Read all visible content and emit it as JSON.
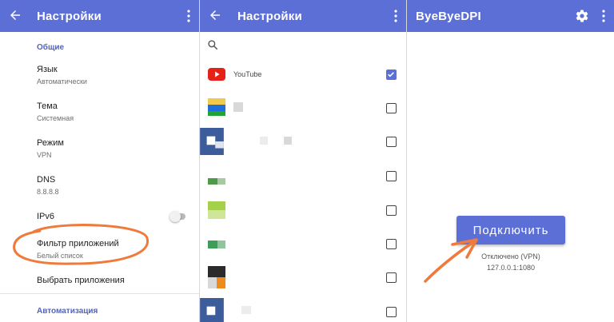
{
  "screens": [
    {
      "title": "Настройки",
      "general_section": "Общие",
      "items": [
        {
          "title": "Язык",
          "subtitle": "Автоматически"
        },
        {
          "title": "Тема",
          "subtitle": "Системная"
        },
        {
          "title": "Режим",
          "subtitle": "VPN"
        },
        {
          "title": "DNS",
          "subtitle": "8.8.8.8"
        },
        {
          "title": "IPv6"
        },
        {
          "title": "Фильтр приложений",
          "subtitle": "Белый список"
        },
        {
          "title": "Выбрать приложения"
        }
      ],
      "automation_section": "Автоматизация",
      "ipv6_enabled": false
    },
    {
      "title": "Настройки",
      "apps": [
        {
          "name": "YouTube",
          "checked": true
        },
        {
          "checked": false
        },
        {
          "checked": false
        },
        {
          "checked": false
        },
        {
          "checked": false
        },
        {
          "checked": false
        },
        {
          "checked": false
        },
        {
          "checked": false
        }
      ]
    },
    {
      "title": "ByeByeDPI",
      "connect_label": "Подключить",
      "status": "Отключено (VPN)",
      "address": "127.0.0.1:1080"
    }
  ],
  "colors": {
    "accent": "#5b6fd6",
    "annotation": "#ef7a3c"
  },
  "icons": [
    "back-arrow-icon",
    "more-vert-icon",
    "gear-icon",
    "search-icon",
    "youtube-icon",
    "checkbox-icon"
  ]
}
